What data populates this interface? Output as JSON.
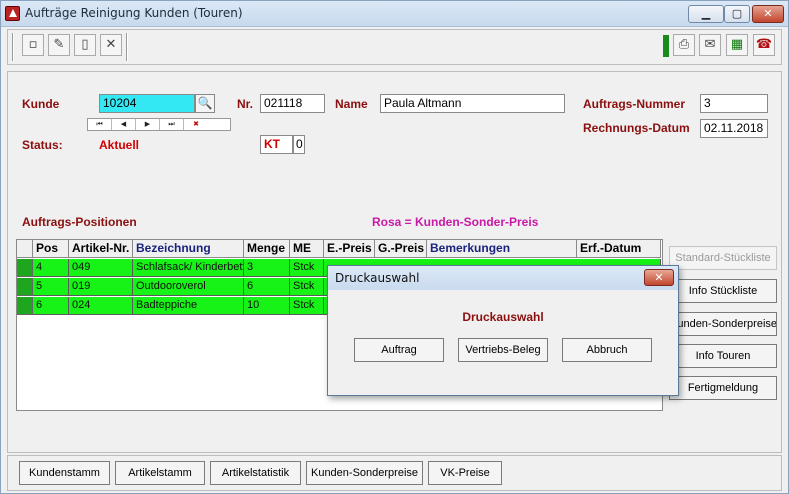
{
  "window": {
    "title": "Aufträge Reinigung Kunden (Touren)",
    "min_glyph": "▁",
    "max_glyph": "▢",
    "close_glyph": "✕"
  },
  "toolbar": {
    "left_icons": [
      "new-icon",
      "edit-icon",
      "blank-page-icon",
      "delete-icon"
    ],
    "left_glyphs": [
      "▫",
      "✎",
      "▯",
      "✕"
    ],
    "right_icons": [
      "print-icon",
      "print-preview-icon",
      "excel-icon",
      "phone-icon"
    ],
    "right_glyphs": [
      "⎙",
      "✉",
      "▦",
      "☎"
    ]
  },
  "form": {
    "kunde_label": "Kunde",
    "kunde_value": "10204",
    "nr_label": "Nr.",
    "nr_value": "021118",
    "name_label": "Name",
    "name_value": "Paula Altmann",
    "auftragsnummer_label": "Auftrags-Nummer",
    "auftragsnummer_value": "3",
    "rechnungsdatum_label": "Rechnungs-Datum",
    "rechnungsdatum_value": "02.11.2018",
    "status_label": "Status:",
    "status_value": "Aktuell",
    "kt_label": "KT",
    "kt_value": "0",
    "search_glyph": "🔍"
  },
  "navigator": {
    "buttons": [
      "⏮",
      "◀",
      "▶",
      "⏭",
      "✖"
    ]
  },
  "positions": {
    "title": "Auftrags-Positionen",
    "hint": "Rosa = Kunden-Sonder-Preis",
    "columns": [
      "Pos",
      "Artikel-Nr.",
      "Bezeichnung",
      "Menge",
      "ME",
      "E.-Preis",
      "G.-Preis",
      "Bemerkungen",
      "Erf.-Datum"
    ],
    "rows": [
      [
        "4",
        "049",
        "Schlafsack/ Kinderbett",
        "3",
        "Stck"
      ],
      [
        "5",
        "019",
        "Outdooroverol",
        "6",
        "Stck"
      ],
      [
        "6",
        "024",
        "Badteppiche",
        "10",
        "Stck"
      ]
    ]
  },
  "side_buttons": {
    "standard_stueckliste": "Standard-Stückliste",
    "info_stueckliste": "Info Stückliste",
    "kunden_sonderpreise": "Kunden-Sonderpreise",
    "info_touren": "Info Touren",
    "fertigmeldung": "Fertigmeldung"
  },
  "bottom_buttons": [
    "Kundenstamm",
    "Artikelstamm",
    "Artikelstatistik",
    "Kunden-Sonderpreise",
    "VK-Preise"
  ],
  "dialog": {
    "title": "Druckauswahl",
    "heading": "Druckauswahl",
    "close_glyph": "✕",
    "buttons": {
      "auftrag": "Auftrag",
      "vertriebs_beleg": "Vertriebs-Beleg",
      "abbruch": "Abbruch"
    }
  }
}
